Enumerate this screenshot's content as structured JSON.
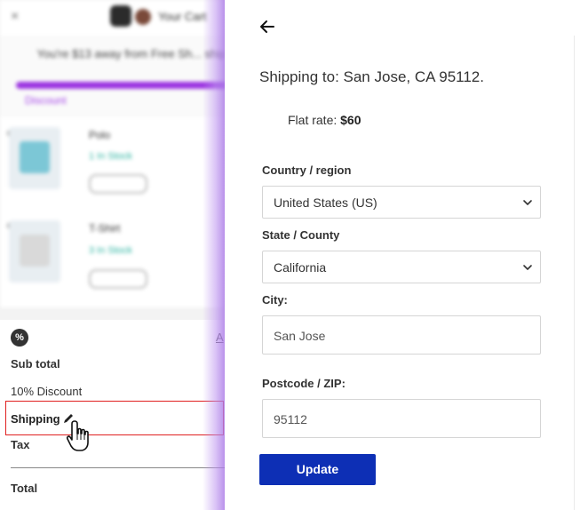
{
  "cart": {
    "title": "Your Cart",
    "close_glyph": "×",
    "notice": "You're $13 away from Free Sh... ship",
    "discount_link": "Discount",
    "items": [
      {
        "name": "Polo",
        "stock": "1 In Stock",
        "shirt_color": "#7cc7d6"
      },
      {
        "name": "T-Shirt",
        "stock": "3 In Stock",
        "shirt_color": "#d9d9d9"
      }
    ],
    "coupon_icon": "%",
    "apply_link": "A",
    "summary": {
      "subtotal": "Sub total",
      "discount": "10% Discount",
      "shipping": "Shipping",
      "tax": "Tax",
      "total": "Total"
    }
  },
  "shipping": {
    "back_icon": "back-arrow-icon",
    "shipping_to": "Shipping to: San Jose, CA 95112.",
    "flat_rate_label": "Flat rate:",
    "flat_rate_value": "$60",
    "country_label": "Country / region",
    "country_value": "United States (US)",
    "state_label": "State / County",
    "state_value": "California",
    "city_label": "City:",
    "city_value": "San Jose",
    "postcode_label": "Postcode / ZIP:",
    "postcode_value": "95112",
    "update_label": "Update"
  },
  "colors": {
    "accent": "#0d2fb5",
    "highlight": "#e02020",
    "progress": "#9b33e0"
  }
}
